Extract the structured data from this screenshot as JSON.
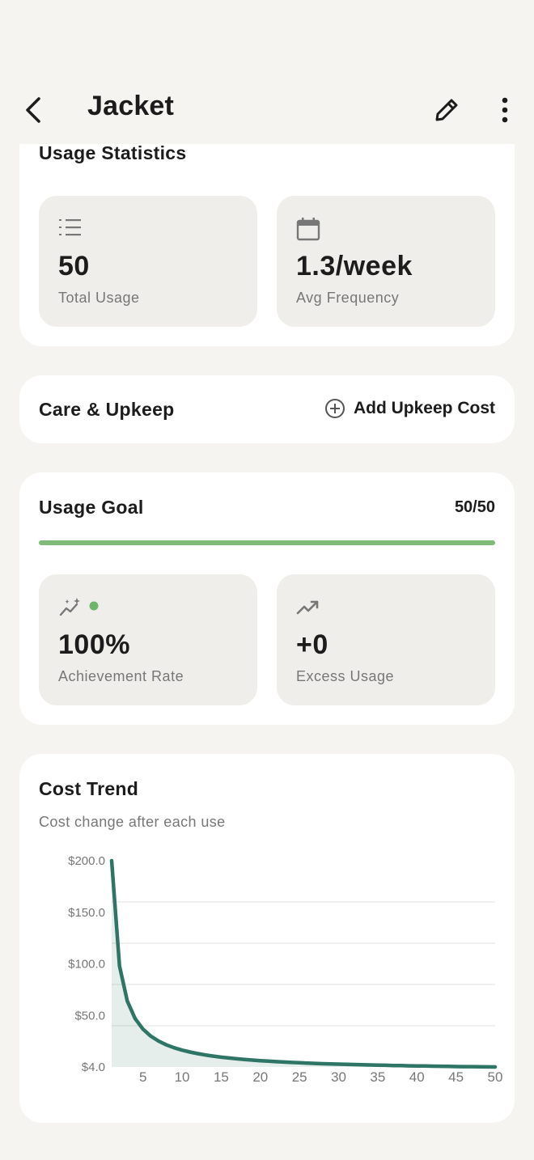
{
  "header": {
    "title": "Jacket"
  },
  "usage_statistics": {
    "title": "Usage Statistics",
    "tiles": [
      {
        "icon": "numbered-list-icon",
        "value": "50",
        "label": "Total Usage"
      },
      {
        "icon": "calendar-icon",
        "value": "1.3/week",
        "label": "Avg Frequency"
      }
    ]
  },
  "care": {
    "title": "Care & Upkeep",
    "add_label": "Add Upkeep Cost"
  },
  "goal": {
    "title": "Usage Goal",
    "count": "50/50",
    "progress": 1.0,
    "tiles": [
      {
        "icon": "sparkle-chart-icon",
        "value": "100%",
        "label": "Achievement Rate"
      },
      {
        "icon": "trending-up-icon",
        "value": "+0",
        "label": "Excess Usage"
      }
    ]
  },
  "colors": {
    "accent": "#2e7566",
    "progress": "#80ba78",
    "dot": "#6db56a",
    "background": "#f5f4f1"
  },
  "cost_trend": {
    "title": "Cost Trend",
    "subtitle": "Cost change after each use"
  },
  "chart_data": {
    "type": "area",
    "title": "Cost Trend",
    "xlabel": "",
    "ylabel": "",
    "x_ticks": [
      "5",
      "10",
      "15",
      "20",
      "25",
      "30",
      "35",
      "40",
      "45",
      "50"
    ],
    "y_ticks": [
      "$4.0",
      "$50.0",
      "$100.0",
      "$150.0",
      "$200.0"
    ],
    "xlim": [
      1,
      50
    ],
    "ylim": [
      4,
      200
    ],
    "grid": true,
    "series": [
      {
        "x": [
          1,
          2,
          3,
          4,
          5,
          6,
          7,
          8,
          9,
          10,
          11,
          12,
          13,
          14,
          15,
          16,
          17,
          18,
          19,
          20,
          21,
          22,
          23,
          24,
          25,
          26,
          27,
          28,
          29,
          30,
          31,
          32,
          33,
          34,
          35,
          36,
          37,
          38,
          39,
          40,
          41,
          42,
          43,
          44,
          45,
          46,
          47,
          48,
          49,
          50
        ],
        "values": [
          200,
          100,
          66.7,
          50,
          40,
          33.3,
          28.6,
          25,
          22.2,
          20,
          18.2,
          16.7,
          15.4,
          14.3,
          13.3,
          12.5,
          11.8,
          11.1,
          10.5,
          10,
          9.5,
          9.1,
          8.7,
          8.3,
          8,
          7.7,
          7.4,
          7.1,
          6.9,
          6.7,
          6.5,
          6.3,
          6.1,
          5.9,
          5.7,
          5.6,
          5.4,
          5.3,
          5.1,
          5,
          4.9,
          4.8,
          4.7,
          4.5,
          4.4,
          4.3,
          4.3,
          4.2,
          4.1,
          4
        ]
      }
    ]
  }
}
